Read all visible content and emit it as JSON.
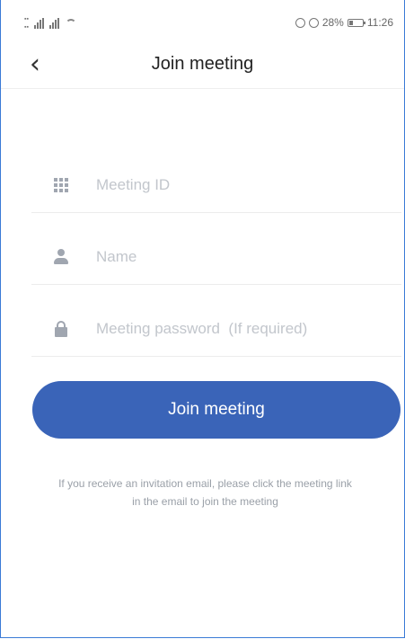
{
  "status_bar": {
    "battery_text": "28%",
    "time": "11:26"
  },
  "header": {
    "back_glyph": "‹",
    "title": "Join meeting"
  },
  "form": {
    "meeting_id": {
      "placeholder": "Meeting ID",
      "value": "",
      "icon": "grid-icon"
    },
    "name": {
      "placeholder": "Name",
      "value": "",
      "icon": "user-icon"
    },
    "password": {
      "placeholder": "Meeting password  (If required)",
      "value": "",
      "icon": "lock-icon"
    }
  },
  "join_button": {
    "label": "Join meeting"
  },
  "hint": {
    "line1": "If you receive an invitation email, please click the meeting link",
    "line2": "in the email to join the meeting"
  },
  "colors": {
    "accent": "#3a64b8",
    "placeholder": "#c2c6cc",
    "icon": "#a0a6b0",
    "hint": "#9aa0a8"
  }
}
